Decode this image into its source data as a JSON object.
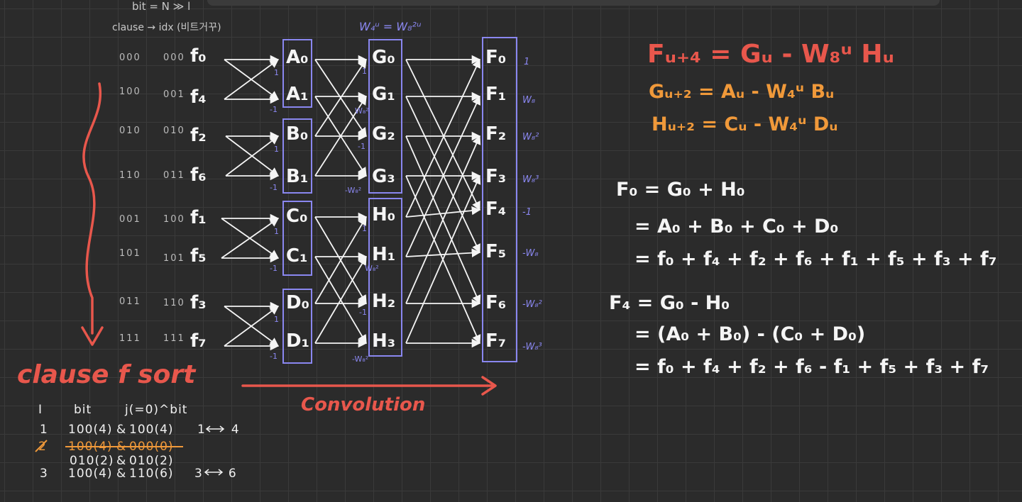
{
  "header": {
    "line1": "bit = N ≫ l",
    "line2": "clause → idx (비트거꾸)"
  },
  "bits_left": [
    "000",
    "100",
    "010",
    "110",
    "001",
    "101",
    "011",
    "111"
  ],
  "bits_right": [
    "000",
    "001",
    "010",
    "011",
    "100",
    "101",
    "110",
    "111"
  ],
  "inputs": [
    "f₀",
    "f₄",
    "f₂",
    "f₆",
    "f₁",
    "f₅",
    "f₃",
    "f₇"
  ],
  "stage1": [
    "A₀",
    "A₁",
    "B₀",
    "B₁",
    "C₀",
    "C₁",
    "D₀",
    "D₁"
  ],
  "stage2": [
    "G₀",
    "G₁",
    "G₂",
    "G₃",
    "H₀",
    "H₁",
    "H₂",
    "H₃"
  ],
  "outputs": [
    "F₀",
    "F₁",
    "F₂",
    "F₃",
    "F₄",
    "F₅",
    "F₆",
    "F₇"
  ],
  "twiddles_out": [
    "1",
    "W₈",
    "W₈²",
    "W₈³",
    "-1",
    "-W₈",
    "-W₈²",
    "-W₈³"
  ],
  "stage1_weights": [
    "1",
    "-1",
    "1",
    "-1",
    "1",
    "-1",
    "1",
    "-1"
  ],
  "stage2_weights": [
    "1",
    "W₈²",
    "-1",
    "-W₈²",
    "1",
    "W₈²",
    "-1",
    "-W₈²"
  ],
  "stage2_header": "W₄ᵘ = W₈²ᵘ",
  "labels": {
    "sort": "clause f sort",
    "convolution": "Convolution"
  },
  "formulas": {
    "red": "Fᵤ₊₄ = Gᵤ - W₈ᵘ Hᵤ",
    "orange1": "Gᵤ₊₂ = Aᵤ - W₄ᵘ Bᵤ",
    "orange2": "Hᵤ₊₂ = Cᵤ - W₄ᵘ Dᵤ"
  },
  "derivation": {
    "f0_line1": "F₀ = G₀ + H₀",
    "f0_line2": "= A₀ + B₀ +  C₀ + D₀",
    "f0_line3": "= f₀ + f₄ + f₂ + f₆ + f₁ + f₅ + f₃ + f₇",
    "f4_line1": "F₄ = G₀ - H₀",
    "f4_line2": "= (A₀ + B₀) - (C₀ + D₀)",
    "f4_line3": "= f₀ + f₄ + f₂ + f₆ - f₁ + f₅ + f₃ + f₇"
  },
  "table": {
    "headers": [
      "I",
      "bit",
      "j(=0)^bit"
    ],
    "rows": [
      {
        "i": "1",
        "bit": "100(4)",
        "amp": "&",
        "j": "100(4)",
        "swap": "1⟷4",
        "struck": false
      },
      {
        "i": "2",
        "bit": "100(4)",
        "amp": "&",
        "j": "000(0)",
        "swap": "",
        "struck": true
      },
      {
        "i": "",
        "bit": "010(2)",
        "amp": "&",
        "j": "010(2)",
        "swap": "",
        "struck": false
      },
      {
        "i": "3",
        "bit": "100(4)",
        "amp": "&",
        "j": "110(6)",
        "swap": "3⟷6",
        "struck": false
      }
    ]
  },
  "colors": {
    "background": "#2b2b2b",
    "grid": "#3a3a3a",
    "blue": "#8a87f0",
    "red": "#e8574c",
    "orange": "#f0993a",
    "white": "#f5f5f5"
  }
}
